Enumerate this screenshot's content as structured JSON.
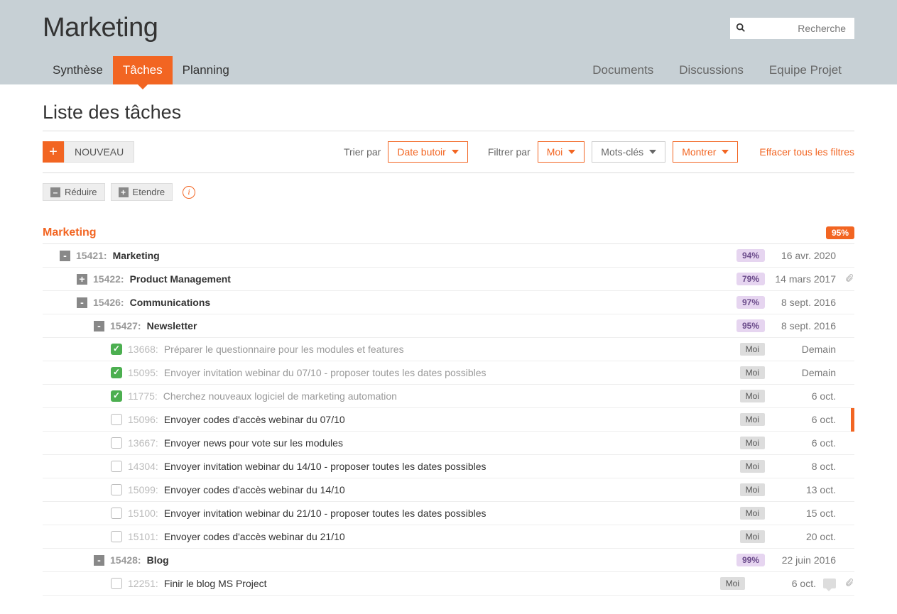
{
  "header": {
    "title": "Marketing",
    "search_placeholder": "Recherche",
    "nav_left": [
      "Synthèse",
      "Tâches",
      "Planning"
    ],
    "nav_left_active": 1,
    "nav_right": [
      "Documents",
      "Discussions",
      "Equipe Projet"
    ]
  },
  "section_title": "Liste des tâches",
  "toolbar": {
    "new_label": "NOUVEAU",
    "sort_label": "Trier par",
    "sort_value": "Date butoir",
    "filter_label": "Filtrer par",
    "filter_value": "Moi",
    "keywords_value": "Mots-clés",
    "show_value": "Montrer",
    "clear_link": "Effacer tous les filtres"
  },
  "expand": {
    "collapse": "Réduire",
    "expand": "Etendre"
  },
  "root": {
    "title": "Marketing",
    "pct": "95%"
  },
  "groups": [
    {
      "indent": 1,
      "toggle": "-",
      "id": "15421:",
      "name": "Marketing",
      "pct": "94%",
      "date": "16 avr. 2020",
      "clip": false
    },
    {
      "indent": 2,
      "toggle": "+",
      "id": "15422:",
      "name": "Product Management",
      "pct": "79%",
      "date": "14 mars 2017",
      "clip": true
    },
    {
      "indent": 2,
      "toggle": "-",
      "id": "15426:",
      "name": "Communications",
      "pct": "97%",
      "date": "8 sept. 2016",
      "clip": false
    },
    {
      "indent": 3,
      "toggle": "-",
      "id": "15427:",
      "name": "Newsletter",
      "pct": "95%",
      "date": "8 sept. 2016",
      "clip": false
    }
  ],
  "tasks": [
    {
      "done": true,
      "id": "13668:",
      "title": "Préparer le questionnaire pour les modules et features",
      "who": "Moi",
      "date": "Demain",
      "mark": false
    },
    {
      "done": true,
      "id": "15095:",
      "title": "Envoyer invitation webinar du 07/10 - proposer toutes les dates possibles",
      "who": "Moi",
      "date": "Demain",
      "mark": false
    },
    {
      "done": true,
      "id": "11775:",
      "title": "Cherchez nouveaux logiciel de marketing automation",
      "who": "Moi",
      "date": "6 oct.",
      "mark": false
    },
    {
      "done": false,
      "id": "15096:",
      "title": "Envoyer codes d'accès webinar du 07/10",
      "who": "Moi",
      "date": "6 oct.",
      "mark": true
    },
    {
      "done": false,
      "id": "13667:",
      "title": "Envoyer news pour vote sur les modules",
      "who": "Moi",
      "date": "6 oct.",
      "mark": false
    },
    {
      "done": false,
      "id": "14304:",
      "title": "Envoyer invitation webinar du 14/10 - proposer toutes les dates possibles",
      "who": "Moi",
      "date": "8 oct.",
      "mark": false
    },
    {
      "done": false,
      "id": "15099:",
      "title": "Envoyer codes d'accès webinar du 14/10",
      "who": "Moi",
      "date": "13 oct.",
      "mark": false
    },
    {
      "done": false,
      "id": "15100:",
      "title": "Envoyer invitation webinar du 21/10 - proposer toutes les dates possibles",
      "who": "Moi",
      "date": "15 oct.",
      "mark": false
    },
    {
      "done": false,
      "id": "15101:",
      "title": "Envoyer codes d'accès webinar du 21/10",
      "who": "Moi",
      "date": "20 oct.",
      "mark": false
    }
  ],
  "group_blog": {
    "toggle": "-",
    "id": "15428:",
    "name": "Blog",
    "pct": "99%",
    "date": "22 juin 2016"
  },
  "task_blog": {
    "done": false,
    "id": "12251:",
    "title": "Finir le blog MS Project",
    "who": "Moi",
    "date": "6 oct."
  }
}
